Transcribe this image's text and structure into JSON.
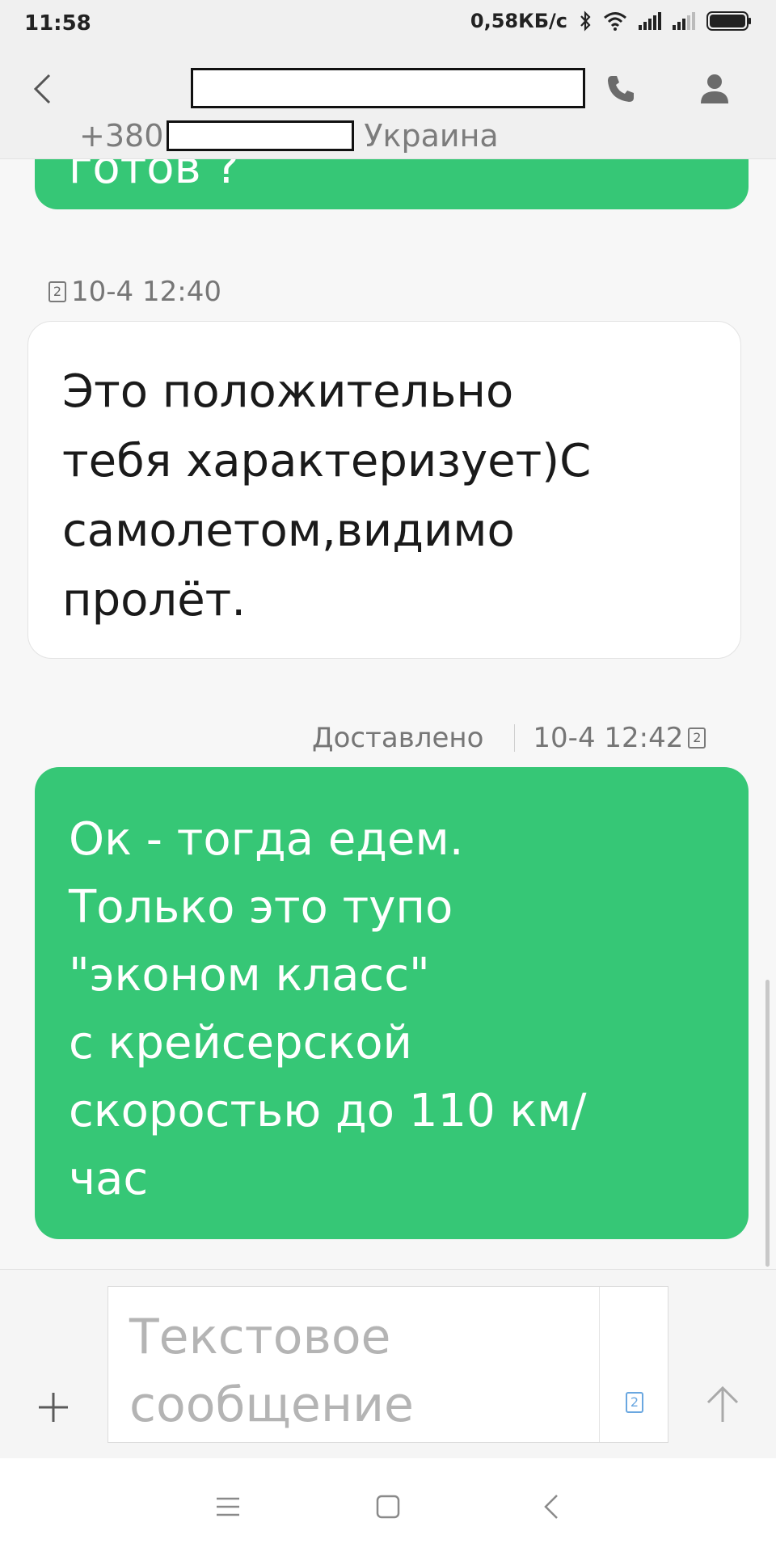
{
  "status_bar": {
    "time": "11:58",
    "network_speed": "0,58КБ/с",
    "icons": [
      "bluetooth-icon",
      "wifi-icon",
      "signal-icon",
      "signal-icon-2",
      "battery-icon"
    ]
  },
  "header": {
    "back_icon": "chevron-left-icon",
    "title": "",
    "phone_prefix": "+380",
    "country": "Украина",
    "call_icon": "phone-icon",
    "contact_icon": "person-icon"
  },
  "messages": [
    {
      "direction": "out",
      "text": "готов ?",
      "partial": true
    },
    {
      "direction": "in",
      "sim": "2",
      "timestamp": "10-4 12:40",
      "text": "Это положительно\nтебя характеризует)С\nсамолетом,видимо\nпролёт."
    },
    {
      "direction": "out",
      "status": "Доставлено",
      "timestamp": "10-4 12:42",
      "sim": "2",
      "text": "Ок - тогда едем.\nТолько это тупо\n\"эконом класс\"\nс крейсерской\nскоростью до 110 км/\nчас"
    }
  ],
  "composer": {
    "placeholder": "Текстовое\nсообщение",
    "add_icon": "plus-icon",
    "sim_label": "2",
    "send_icon": "arrow-up-icon"
  },
  "nav_bar": {
    "icons": [
      "menu-icon",
      "home-icon",
      "back-icon"
    ]
  },
  "colors": {
    "outgoing_bubble": "#36c776",
    "incoming_bubble": "#ffffff",
    "background": "#f7f7f7",
    "header": "#f0f0f0"
  }
}
